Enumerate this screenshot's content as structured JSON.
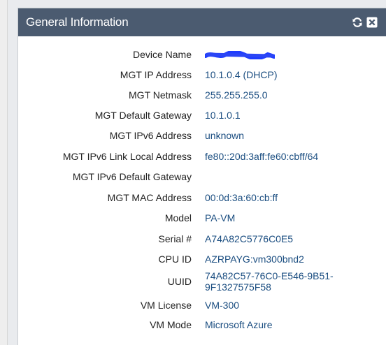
{
  "panel": {
    "title": "General Information",
    "accent": "#4b5b70",
    "value_color": "#1a4d80",
    "header_icons": [
      "refresh-icon",
      "close-icon"
    ]
  },
  "rows": [
    {
      "label": "Device Name",
      "value": ""
    },
    {
      "label": "MGT IP Address",
      "value": "10.1.0.4 (DHCP)"
    },
    {
      "label": "MGT Netmask",
      "value": "255.255.255.0"
    },
    {
      "label": "MGT Default Gateway",
      "value": "10.1.0.1"
    },
    {
      "label": "MGT IPv6 Address",
      "value": "unknown"
    },
    {
      "label": "MGT IPv6 Link Local Address",
      "value": "fe80::20d:3aff:fe60:cbff/64"
    },
    {
      "label": "MGT IPv6 Default Gateway",
      "value": ""
    },
    {
      "label": "MGT MAC Address",
      "value": "00:0d:3a:60:cb:ff"
    },
    {
      "label": "Model",
      "value": "PA-VM"
    },
    {
      "label": "Serial #",
      "value": "A74A82C5776C0E5"
    },
    {
      "label": "CPU ID",
      "value": "AZRPAYG:vm300bnd2"
    },
    {
      "label": "UUID",
      "value": "74A82C57-76C0-E546-9B51-9F1327575F58"
    },
    {
      "label": "VM License",
      "value": "VM-300"
    },
    {
      "label": "VM Mode",
      "value": "Microsoft Azure"
    }
  ]
}
